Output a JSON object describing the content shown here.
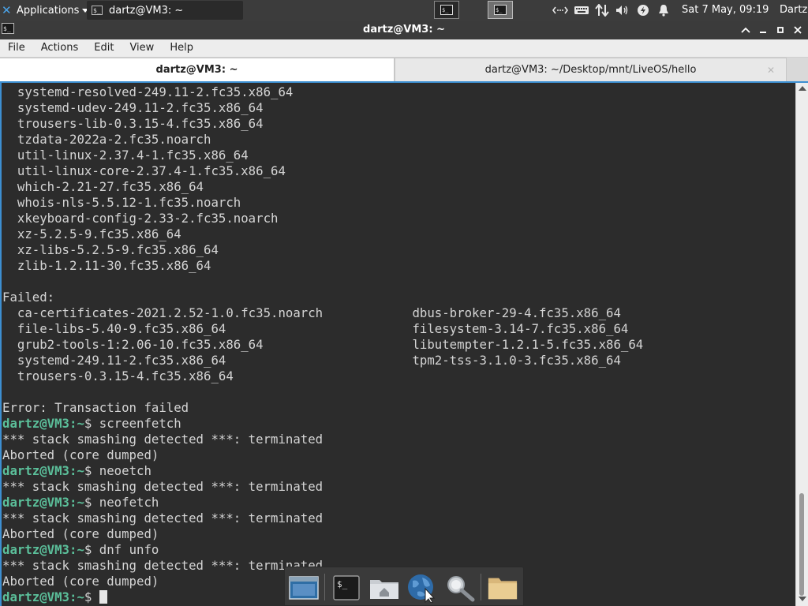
{
  "panel": {
    "applications_label": "Applications",
    "task_title": "dartz@VM3: ~",
    "clock": "Sat  7 May, 09:19",
    "user": "Dartz"
  },
  "window": {
    "title": "dartz@VM3: ~"
  },
  "menubar": {
    "items": [
      "File",
      "Actions",
      "Edit",
      "View",
      "Help"
    ]
  },
  "tabs": [
    {
      "label": "dartz@VM3: ~",
      "active": true
    },
    {
      "label": "dartz@VM3: ~/Desktop/mnt/LiveOS/hello",
      "active": false
    }
  ],
  "terminal": {
    "lines": [
      {
        "text": "  systemd-resolved-249.11-2.fc35.x86_64"
      },
      {
        "text": "  systemd-udev-249.11-2.fc35.x86_64"
      },
      {
        "text": "  trousers-lib-0.3.15-4.fc35.x86_64"
      },
      {
        "text": "  tzdata-2022a-2.fc35.noarch"
      },
      {
        "text": "  util-linux-2.37.4-1.fc35.x86_64"
      },
      {
        "text": "  util-linux-core-2.37.4-1.fc35.x86_64"
      },
      {
        "text": "  which-2.21-27.fc35.x86_64"
      },
      {
        "text": "  whois-nls-5.5.12-1.fc35.noarch"
      },
      {
        "text": "  xkeyboard-config-2.33-2.fc35.noarch"
      },
      {
        "text": "  xz-5.2.5-9.fc35.x86_64"
      },
      {
        "text": "  xz-libs-5.2.5-9.fc35.x86_64"
      },
      {
        "text": "  zlib-1.2.11-30.fc35.x86_64"
      },
      {
        "text": ""
      },
      {
        "text": "Failed:"
      },
      {
        "text": "  ca-certificates-2021.2.52-1.0.fc35.noarch            dbus-broker-29-4.fc35.x86_64"
      },
      {
        "text": "  file-libs-5.40-9.fc35.x86_64                         filesystem-3.14-7.fc35.x86_64"
      },
      {
        "text": "  grub2-tools-1:2.06-10.fc35.x86_64                    libutempter-1.2.1-5.fc35.x86_64"
      },
      {
        "text": "  systemd-249.11-2.fc35.x86_64                         tpm2-tss-3.1.0-3.fc35.x86_64"
      },
      {
        "text": "  trousers-0.3.15-4.fc35.x86_64"
      },
      {
        "text": ""
      },
      {
        "text": "Error: Transaction failed"
      },
      {
        "prompt": "dartz@VM3:~",
        "command": "$ screenfetch"
      },
      {
        "text": "*** stack smashing detected ***: terminated"
      },
      {
        "text": "Aborted (core dumped)"
      },
      {
        "prompt": "dartz@VM3:~",
        "command": "$ neoetch"
      },
      {
        "text": "*** stack smashing detected ***: terminated"
      },
      {
        "prompt": "dartz@VM3:~",
        "command": "$ neofetch"
      },
      {
        "text": "*** stack smashing detected ***: terminated"
      },
      {
        "text": "Aborted (core dumped)"
      },
      {
        "prompt": "dartz@VM3:~",
        "command": "$ dnf unfo"
      },
      {
        "text": "*** stack smashing detected ***: terminated"
      },
      {
        "text": "Aborted (core dumped)"
      },
      {
        "prompt": "dartz@VM3:~",
        "command": "$ ",
        "cursor": true
      }
    ]
  },
  "dock": {
    "items": [
      "show-desktop-icon",
      "terminal-icon",
      "home-folder-icon",
      "web-browser-icon",
      "app-finder-icon",
      "files-icon"
    ]
  },
  "colors": {
    "prompt": "#5bbf9a",
    "accent": "#3d8fd1",
    "terminal_bg": "#2c2c2c",
    "terminal_fg": "#d4d4d4"
  }
}
